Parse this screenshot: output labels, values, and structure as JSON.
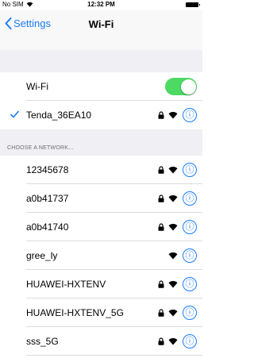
{
  "status_bar": {
    "carrier": "No SIM",
    "time": "12:32 PM"
  },
  "nav": {
    "back_label": "Settings",
    "title": "Wi-Fi"
  },
  "wifi_toggle": {
    "label": "Wi-Fi",
    "on": true
  },
  "connected": {
    "name": "Tenda_36EA10",
    "secured": true
  },
  "section_header": "CHOOSE A NETWORK...",
  "networks": [
    {
      "name": "12345678",
      "secured": true
    },
    {
      "name": "a0b41737",
      "secured": true
    },
    {
      "name": "a0b41740",
      "secured": true
    },
    {
      "name": "gree_ly",
      "secured": false
    },
    {
      "name": "HUAWEI-HXTENV",
      "secured": true
    },
    {
      "name": "HUAWEI-HXTENV_5G",
      "secured": true
    },
    {
      "name": "sss_5G",
      "secured": true
    }
  ],
  "colors": {
    "accent": "#1a7cf7",
    "toggle_on": "#4cd964",
    "group_bg": "#efeff4"
  },
  "icons": {
    "info": "ⓘ"
  }
}
